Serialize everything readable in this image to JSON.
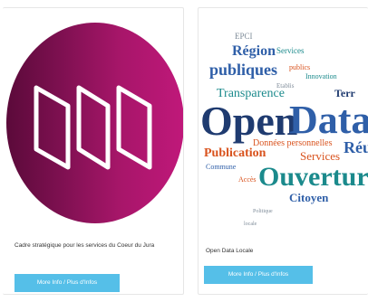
{
  "cards": [
    {
      "caption": "Cadre stratégique pour les services du Coeur du Jura",
      "button_label": "More Info / Plus d'Infos",
      "image_icon": "folded-map-icon",
      "colors": {
        "circle_dark": "#5b0a3a",
        "circle_light": "#c0187a",
        "icon_stroke": "#ffffff"
      }
    },
    {
      "caption": "Open Data Locale",
      "button_label": "More Info / Plus d'Infos",
      "image_icon": "open-data-word-cloud",
      "wordcloud": {
        "open": "Open",
        "data": "Data",
        "ouverture": "Ouvertur",
        "publiques": "publiques",
        "region": "Région",
        "transparence": "Transparence",
        "publication": "Publication",
        "donnees": "Données personnelles",
        "services": "Services",
        "citoyen": "Citoyen",
        "reu": "Réu",
        "terr": "Terr",
        "acces": "Accès",
        "commune": "Commune",
        "publics": "publics",
        "epci": "EPCI",
        "etablissements": "Etablis",
        "innovation": "Innovation",
        "politique": "Politique",
        "locale": "locale"
      },
      "colors": {
        "blue": "#2f5fa8",
        "teal": "#1b8a8c",
        "orange": "#d9531e",
        "navy": "#1f3b70",
        "gray": "#7f8c99"
      }
    }
  ]
}
